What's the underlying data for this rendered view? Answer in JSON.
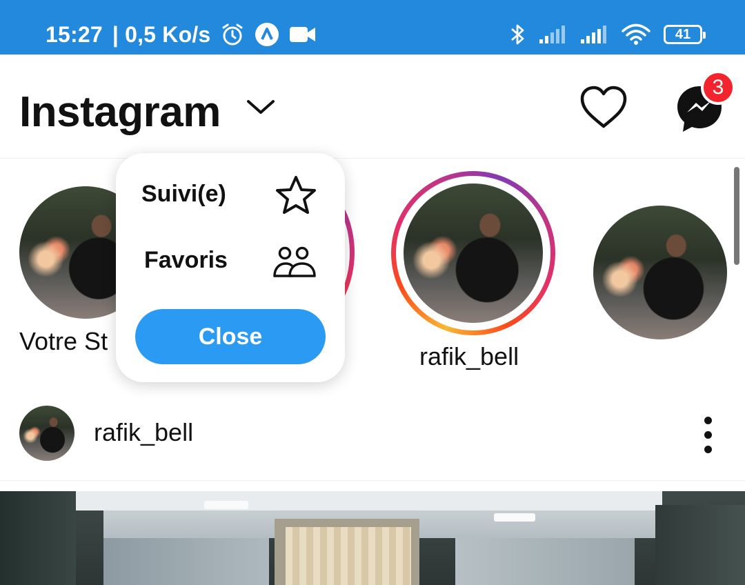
{
  "status_bar": {
    "time": "15:27",
    "network_speed": "| 0,5 Ko/s",
    "battery_level": "41",
    "icons": [
      "alarm-icon",
      "app-a-icon",
      "video-camera-icon",
      "bluetooth-icon",
      "signal-1-icon",
      "signal-2-icon",
      "wifi-icon",
      "battery-icon"
    ],
    "background_color": "#2389dc"
  },
  "header": {
    "app_title": "Instagram",
    "notifications_badge": "3",
    "icons": [
      "chevron-down-icon",
      "heart-icon",
      "messenger-icon"
    ]
  },
  "stories": [
    {
      "label": "Votre Story",
      "visible_label": "Votre St",
      "ring": false
    },
    {
      "label": "",
      "ring": true,
      "partially_hidden": true
    },
    {
      "label": "rafik_bell",
      "ring": true
    },
    {
      "label": "",
      "ring": false
    }
  ],
  "feed_menu": {
    "items": [
      {
        "label": "Suivi(e)",
        "icon": "star-icon"
      },
      {
        "label": "Favoris",
        "icon": "people-icon"
      }
    ],
    "close_label": "Close",
    "close_color": "#2b9af3"
  },
  "post": {
    "username": "rafik_bell",
    "menu_icon": "more-vertical-icon"
  },
  "colors": {
    "accent_blue": "#2b9af3",
    "badge_red": "#f2252f",
    "story_ring": [
      "#f7b733",
      "#fc4a1a",
      "#e1306c",
      "#c13584",
      "#833ab4"
    ]
  }
}
